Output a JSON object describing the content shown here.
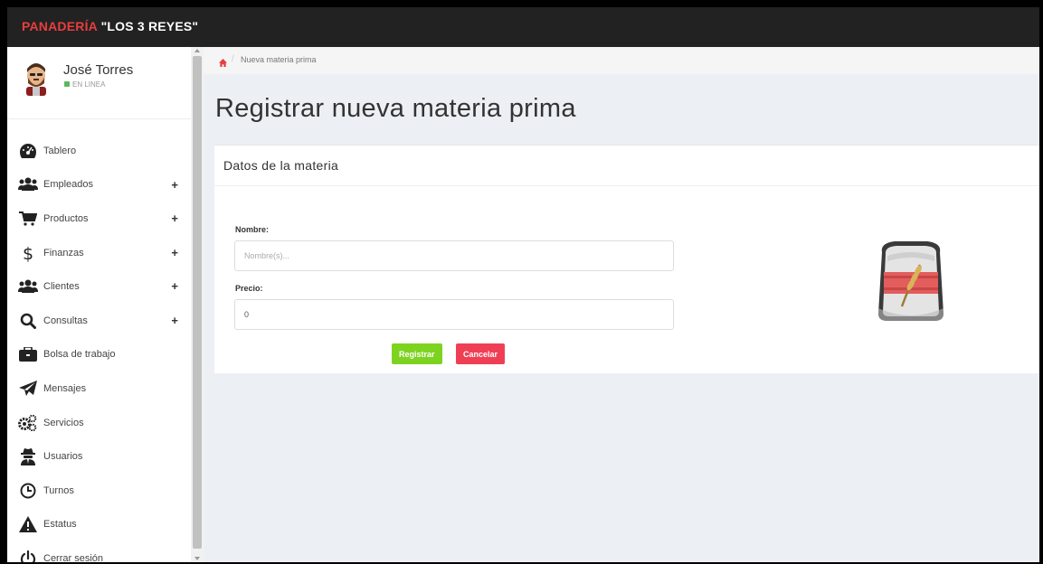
{
  "app": {
    "brand_part1": "PANADERÍA ",
    "brand_part2": "\"LOS 3 REYES\"",
    "brand_color": "#e83e3e"
  },
  "user": {
    "name": "José Torres",
    "status": "EN LINEA",
    "status_color": "#5cb85c"
  },
  "sidebar": {
    "items": [
      {
        "label": "Tablero",
        "icon": "dashboard-icon",
        "expandable": false
      },
      {
        "label": "Empleados",
        "icon": "users-icon",
        "expandable": true
      },
      {
        "label": "Productos",
        "icon": "cart-icon",
        "expandable": true
      },
      {
        "label": "Finanzas",
        "icon": "dollar-icon",
        "expandable": true
      },
      {
        "label": "Clientes",
        "icon": "users-icon",
        "expandable": true
      },
      {
        "label": "Consultas",
        "icon": "search-icon",
        "expandable": true
      },
      {
        "label": "Bolsa de trabajo",
        "icon": "briefcase-icon",
        "expandable": false
      },
      {
        "label": "Mensajes",
        "icon": "paper-plane-icon",
        "expandable": false
      },
      {
        "label": "Servicios",
        "icon": "cogs-icon",
        "expandable": false
      },
      {
        "label": "Usuarios",
        "icon": "user-secret-icon",
        "expandable": false
      },
      {
        "label": "Turnos",
        "icon": "clock-icon",
        "expandable": false
      },
      {
        "label": "Estatus",
        "icon": "warning-icon",
        "expandable": false
      },
      {
        "label": "Cerrar sesión",
        "icon": "power-icon",
        "expandable": false
      }
    ],
    "expand_symbol": "+"
  },
  "breadcrumb": {
    "home_icon": "home-icon",
    "separator": "/",
    "current": "Nueva materia prima"
  },
  "page": {
    "title": "Registrar nueva materia prima"
  },
  "form": {
    "box_title": "Datos de la materia",
    "nombre_label": "Nombre:",
    "nombre_placeholder": "Nombre(s)...",
    "nombre_value": "",
    "precio_label": "Precio:",
    "precio_value": "0",
    "submit_label": "Registrar",
    "cancel_label": "Cancelar",
    "submit_color": "#7ed321",
    "cancel_color": "#ef3f55",
    "illustration": "flour-sack-icon"
  }
}
